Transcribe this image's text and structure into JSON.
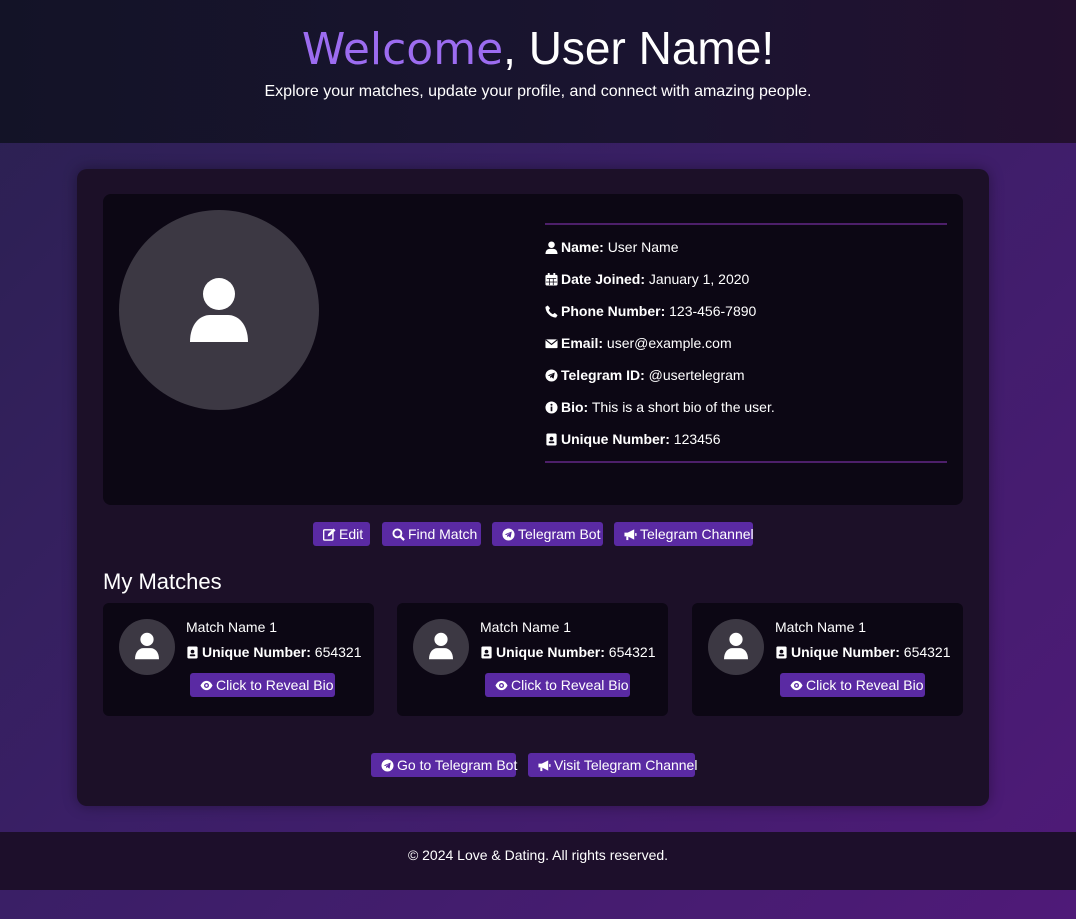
{
  "header": {
    "welcome_word": "Welcome",
    "welcome_rest": ", User Name!",
    "subtitle": "Explore your matches, update your profile, and connect with amazing people.",
    "accent_color": "#9c6cf0"
  },
  "profile": {
    "avatar_icon": "user-icon",
    "fields": [
      {
        "icon": "user-icon",
        "label": "Name:",
        "value": "User Name"
      },
      {
        "icon": "calendar-icon",
        "label": "Date Joined:",
        "value": "January 1, 2020"
      },
      {
        "icon": "phone-icon",
        "label": "Phone Number:",
        "value": "123-456-7890"
      },
      {
        "icon": "envelope-icon",
        "label": "Email:",
        "value": "user@example.com"
      },
      {
        "icon": "telegram-icon",
        "label": "Telegram ID:",
        "value": "@usertelegram"
      },
      {
        "icon": "info-icon",
        "label": "Bio:",
        "value": "This is a short bio of the user."
      },
      {
        "icon": "id-badge-icon",
        "label": "Unique Number:",
        "value": "123456"
      }
    ]
  },
  "actions": {
    "edit": "Edit",
    "find_match": "Find Match",
    "telegram_bot": "Telegram Bot",
    "telegram_channel": "Telegram Channel"
  },
  "matches_section": {
    "title": "My Matches",
    "items": [
      {
        "name": "Match Name 1",
        "number_label": "Unique Number:",
        "number": "654321",
        "reveal_label": "Click to Reveal Bio"
      },
      {
        "name": "Match Name 1",
        "number_label": "Unique Number:",
        "number": "654321",
        "reveal_label": "Click to Reveal Bio"
      },
      {
        "name": "Match Name 1",
        "number_label": "Unique Number:",
        "number": "654321",
        "reveal_label": "Click to Reveal Bio"
      }
    ]
  },
  "bottom_links": {
    "bot": "Go to Telegram Bot",
    "channel": "Visit Telegram Channel"
  },
  "footer": {
    "text": "© 2024 Love & Dating. All rights reserved."
  },
  "colors": {
    "button": "#5a2aa3",
    "panel": "#0c0714",
    "divider": "#4d1f6a"
  }
}
